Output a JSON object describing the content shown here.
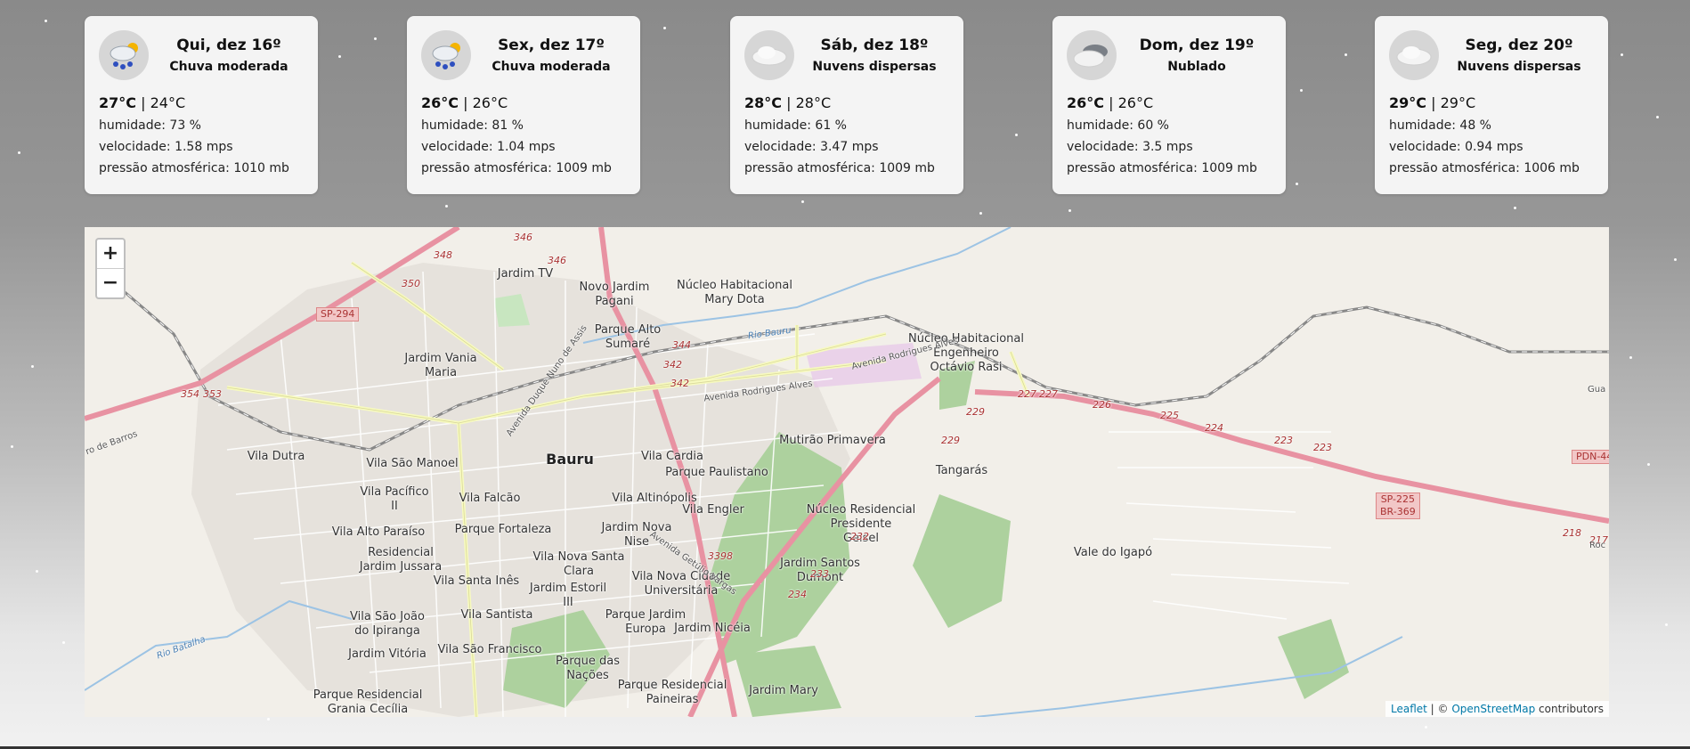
{
  "forecast": [
    {
      "day": "Qui, dez 16º",
      "description": "Chuva moderada",
      "icon": "rain-sun-icon",
      "max": "27°C",
      "min": "24°C",
      "humidity": "humidade: 73 %",
      "wind": "velocidade: 1.58 mps",
      "pressure": "pressão atmosférica: 1010 mb"
    },
    {
      "day": "Sex, dez 17º",
      "description": "Chuva moderada",
      "icon": "rain-sun-icon",
      "max": "26°C",
      "min": "26°C",
      "humidity": "humidade: 81 %",
      "wind": "velocidade: 1.04 mps",
      "pressure": "pressão atmosférica: 1009 mb"
    },
    {
      "day": "Sáb, dez 18º",
      "description": "Nuvens dispersas",
      "icon": "cloud-icon",
      "max": "28°C",
      "min": "28°C",
      "humidity": "humidade: 61 %",
      "wind": "velocidade: 3.47 mps",
      "pressure": "pressão atmosférica: 1009 mb"
    },
    {
      "day": "Dom, dez 19º",
      "description": "Nublado",
      "icon": "dark-cloud-icon",
      "max": "26°C",
      "min": "26°C",
      "humidity": "humidade: 60 %",
      "wind": "velocidade: 3.5 mps",
      "pressure": "pressão atmosférica: 1009 mb"
    },
    {
      "day": "Seg, dez 20º",
      "description": "Nuvens dispersas",
      "icon": "cloud-icon",
      "max": "29°C",
      "min": "29°C",
      "humidity": "humidade: 48 %",
      "wind": "velocidade: 0.94 mps",
      "pressure": "pressão atmosférica: 1006 mb"
    }
  ],
  "map": {
    "zoom_in": "+",
    "zoom_out": "−",
    "attribution": {
      "leaflet": "Leaflet",
      "sep": " | © ",
      "osm": "OpenStreetMap",
      "suffix": " contributors"
    },
    "labels": [
      {
        "t": "Bauru",
        "cls": "big"
      },
      {
        "t": "Jardim TV"
      },
      {
        "t": "Novo Jardim\nPagani"
      },
      {
        "t": "Núcleo Habitacional\nMary Dota"
      },
      {
        "t": "Parque Alto\nSumaré"
      },
      {
        "t": "Jardim Vania\nMaria"
      },
      {
        "t": "Núcleo Habitacional\nEngenheiro\nOctávio Rasi"
      },
      {
        "t": "Mutirão Primavera"
      },
      {
        "t": "Vila Cardia"
      },
      {
        "t": "Parque Paulistano"
      },
      {
        "t": "Tangarás"
      },
      {
        "t": "Vila Dutra"
      },
      {
        "t": "Vila São Manoel"
      },
      {
        "t": "Vila Pacífico\nII"
      },
      {
        "t": "Vila Falcão"
      },
      {
        "t": "Vila Altinópolis"
      },
      {
        "t": "Vila Engler"
      },
      {
        "t": "Núcleo Residencial\nPresidente\nGeisel"
      },
      {
        "t": "Vila Alto Paraíso"
      },
      {
        "t": "Parque Fortaleza"
      },
      {
        "t": "Jardim Nova\nNise"
      },
      {
        "t": "Residencial\nJardim Jussara"
      },
      {
        "t": "Vila Nova Santa\nClara"
      },
      {
        "t": "Jardim Santos\nDumont"
      },
      {
        "t": "Vale do Igapó"
      },
      {
        "t": "Vila Nova Cidade\nUniversitária"
      },
      {
        "t": "Vila Santa Inês"
      },
      {
        "t": "Jardim Estoril\nIII"
      },
      {
        "t": "Vila São João\ndo Ipiranga"
      },
      {
        "t": "Vila Santista"
      },
      {
        "t": "Parque Jardim\nEuropa"
      },
      {
        "t": "Jardim Nicéia"
      },
      {
        "t": "Jardim Vitória"
      },
      {
        "t": "Vila São Francisco"
      },
      {
        "t": "Parque das\nNações"
      },
      {
        "t": "Parque Residencial\nGrania Cecília"
      },
      {
        "t": "Parque Residencial\nPaineiras"
      },
      {
        "t": "Jardim Mary"
      }
    ],
    "shields": [
      "SP-294",
      "SP-225\nBR-369",
      "PDN-44"
    ],
    "road_numbers": [
      "348",
      "346",
      "346",
      "350",
      "344",
      "342",
      "342",
      "354",
      "353",
      "227",
      "227",
      "226",
      "225",
      "224",
      "223",
      "223",
      "229",
      "229",
      "232",
      "233",
      "234",
      "3398",
      "218",
      "217"
    ],
    "road_names": [
      "Avenida Rodrigues Alves",
      "Avenida Rodrigues Alves",
      "Avenida Duque Nuno de Assis",
      "Avenida Getúlio Vargas",
      "Rio Bauru",
      "Rio Batalha",
      "ro de Barros",
      "Roc",
      "Gua"
    ]
  }
}
